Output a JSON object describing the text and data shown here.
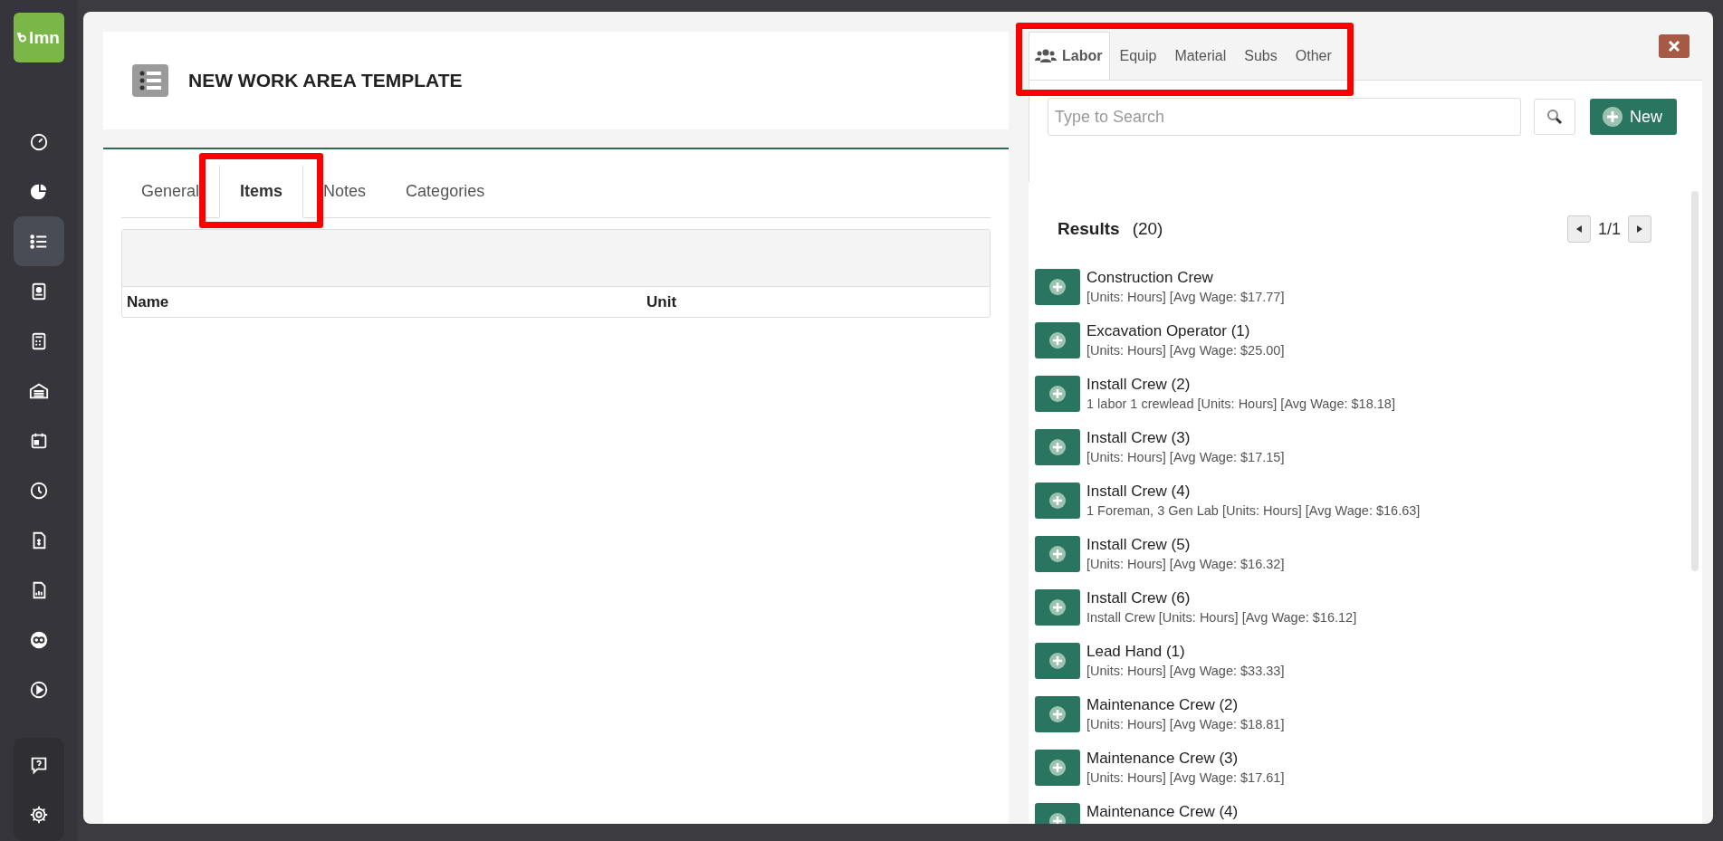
{
  "logo": {
    "text": "lmn"
  },
  "sidebar": {
    "items": [
      {
        "selected": false
      },
      {
        "selected": false
      },
      {
        "selected": true
      },
      {
        "selected": false
      },
      {
        "selected": false
      },
      {
        "selected": false
      },
      {
        "selected": false
      },
      {
        "selected": false
      },
      {
        "selected": false
      },
      {
        "selected": false
      },
      {
        "selected": false
      },
      {
        "selected": false
      }
    ],
    "footer_items": [
      {
        "selected": false
      },
      {
        "selected": false
      }
    ]
  },
  "header": {
    "title": "NEW WORK AREA TEMPLATE"
  },
  "tabs": [
    {
      "label": "General",
      "selected": false,
      "highlighted": false
    },
    {
      "label": "Items",
      "selected": true,
      "highlighted": true
    },
    {
      "label": "Notes",
      "selected": false,
      "highlighted": false
    },
    {
      "label": "Categories",
      "selected": false,
      "highlighted": false
    }
  ],
  "table": {
    "columns": [
      "Name",
      "Unit"
    ]
  },
  "resource_tabs": {
    "highlighted": true,
    "items": [
      {
        "label": "Labor",
        "selected": true
      },
      {
        "label": "Equip",
        "selected": false
      },
      {
        "label": "Material",
        "selected": false
      },
      {
        "label": "Subs",
        "selected": false
      },
      {
        "label": "Other",
        "selected": false
      }
    ]
  },
  "search": {
    "placeholder": "Type to Search"
  },
  "new_button": "New",
  "results": {
    "title": "Results",
    "count": "(20)",
    "page": "1/1",
    "rows": [
      {
        "name": "Construction Crew",
        "detail": "[Units: Hours] [Avg Wage: $17.77]"
      },
      {
        "name": "Excavation Operator (1)",
        "detail": "[Units: Hours] [Avg Wage: $25.00]"
      },
      {
        "name": "Install Crew (2)",
        "detail": "1 labor 1 crewlead [Units: Hours] [Avg Wage: $18.18]"
      },
      {
        "name": "Install Crew (3)",
        "detail": "[Units: Hours] [Avg Wage: $17.15]"
      },
      {
        "name": "Install Crew (4)",
        "detail": "1 Foreman, 3 Gen Lab [Units: Hours] [Avg Wage: $16.63]"
      },
      {
        "name": "Install Crew (5)",
        "detail": "[Units: Hours] [Avg Wage: $16.32]"
      },
      {
        "name": "Install Crew (6)",
        "detail": "Install Crew [Units: Hours] [Avg Wage: $16.12]"
      },
      {
        "name": "Lead Hand (1)",
        "detail": "[Units: Hours] [Avg Wage: $33.33]"
      },
      {
        "name": "Maintenance Crew (2)",
        "detail": "[Units: Hours] [Avg Wage: $18.81]"
      },
      {
        "name": "Maintenance Crew (3)",
        "detail": "[Units: Hours] [Avg Wage: $17.61]"
      },
      {
        "name": "Maintenance Crew (4)"
      }
    ]
  }
}
